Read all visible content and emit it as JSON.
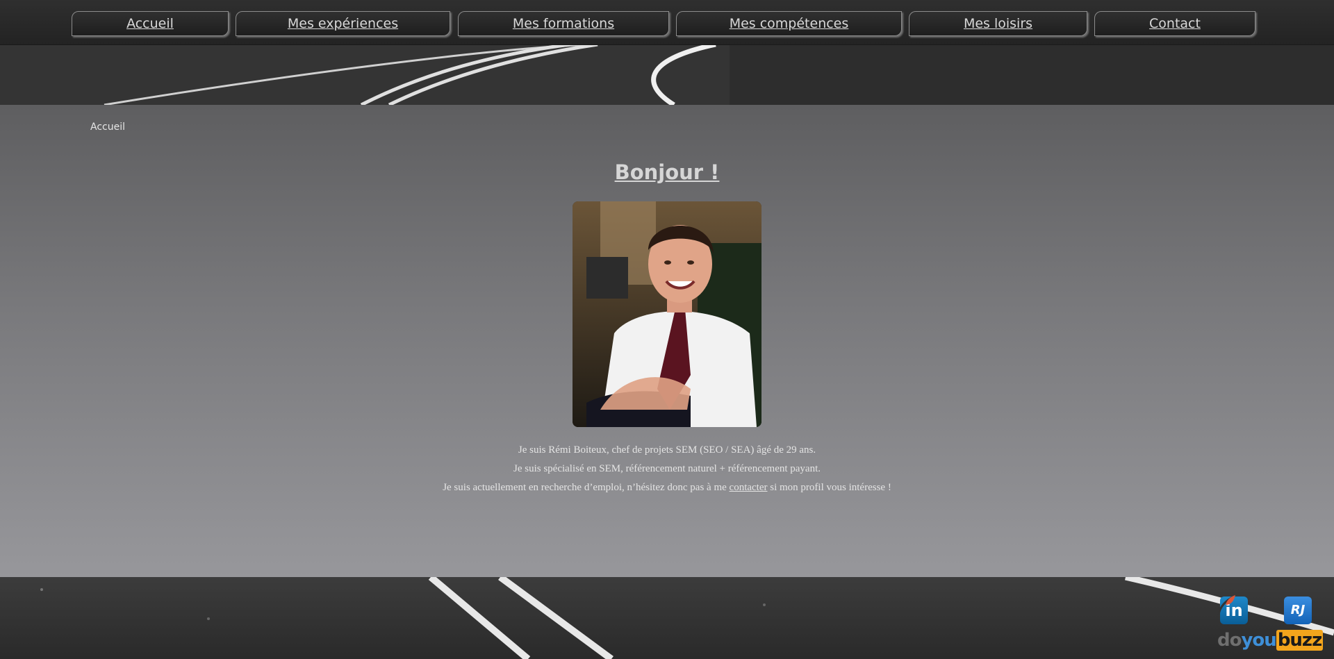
{
  "nav": {
    "items": [
      {
        "label": "Accueil"
      },
      {
        "label": "Mes expériences"
      },
      {
        "label": "Mes formations"
      },
      {
        "label": "Mes compétences"
      },
      {
        "label": "Mes loisirs"
      },
      {
        "label": "Contact"
      }
    ]
  },
  "breadcrumb": "Accueil",
  "main": {
    "title": "Bonjour !",
    "intro": {
      "line1": "Je suis Rémi Boiteux, chef de projets SEM (SEO / SEA) âgé de 29 ans.",
      "line2": "Je suis spécialisé en SEM, référencement naturel + référencement payant.",
      "line3_before": "Je suis actuellement en recherche d’emploi, n’hésitez donc pas à me ",
      "line3_link": "contacter",
      "line3_after": " si mon profil vous intéresse !"
    }
  },
  "social": {
    "linkedin_text": "in",
    "rj_text": "RJ",
    "doyoubuzz": {
      "do": "do",
      "you": "you",
      "buzz": "buzz"
    },
    "icons": [
      "linkedin-icon",
      "leaf-icon",
      "rj-icon",
      "doyoubuzz-logo"
    ]
  },
  "colors": {
    "nav_text": "#d9d9d9",
    "content_top": "#5e5e60",
    "content_bottom": "#97979b",
    "linkedin": "#0a66c2",
    "buzz": "#f3a51c"
  }
}
